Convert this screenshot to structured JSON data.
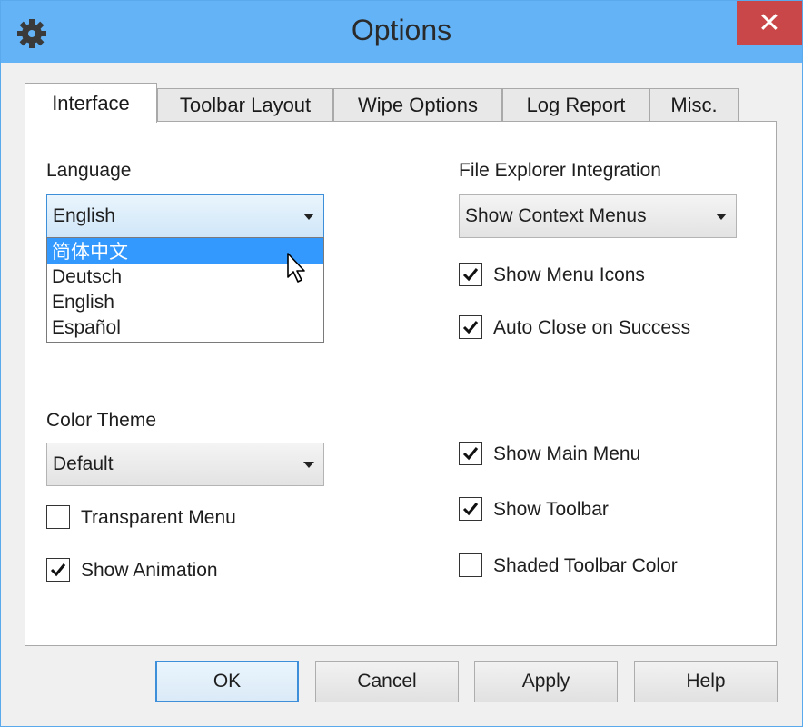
{
  "window": {
    "title": "Options",
    "close_glyph": "✕"
  },
  "tabs": [
    "Interface",
    "Toolbar Layout",
    "Wipe Options",
    "Log Report",
    "Misc."
  ],
  "interface": {
    "language": {
      "label": "Language",
      "value": "English",
      "options": [
        "简体中文",
        "Deutsch",
        "English",
        "Español"
      ],
      "highlighted": "简体中文"
    },
    "color_theme": {
      "label": "Color Theme",
      "value": "Default"
    },
    "transparent_menu": {
      "label": "Transparent Menu",
      "checked": false
    },
    "show_animation": {
      "label": "Show Animation",
      "checked": true
    },
    "file_explorer": {
      "label": "File Explorer Integration",
      "value": "Show Context Menus"
    },
    "show_menu_icons": {
      "label": "Show Menu Icons",
      "checked": true
    },
    "auto_close": {
      "label": "Auto Close on Success",
      "checked": true
    },
    "show_main_menu": {
      "label": "Show Main Menu",
      "checked": true
    },
    "show_toolbar": {
      "label": "Show Toolbar",
      "checked": true
    },
    "shaded_toolbar": {
      "label": "Shaded Toolbar Color",
      "checked": false
    }
  },
  "buttons": {
    "ok": "OK",
    "cancel": "Cancel",
    "apply": "Apply",
    "help": "Help"
  },
  "colors": {
    "titlebar": "#63b3f6",
    "close": "#c94748",
    "selection": "#3399ff"
  },
  "icons": {
    "app": "gear-icon",
    "close": "close-icon",
    "checkmark": "checkmark-icon",
    "cursor": "mouse-pointer-icon"
  }
}
